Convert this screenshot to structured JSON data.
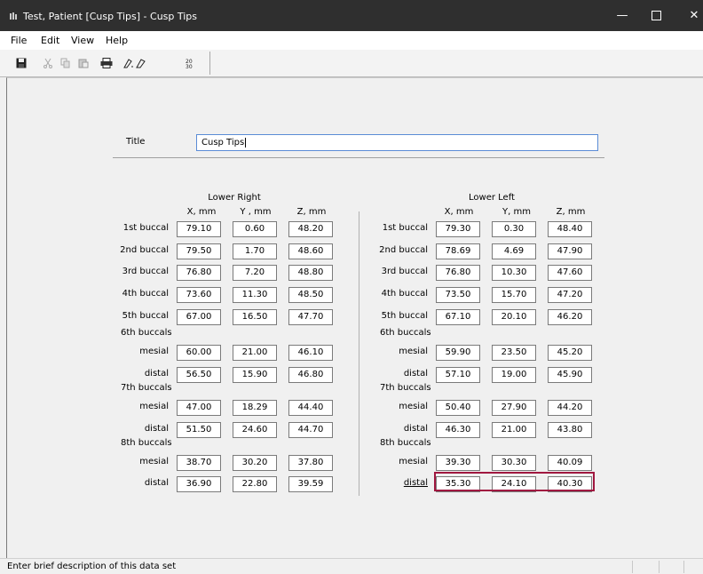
{
  "window": {
    "title": "Test, Patient [Cusp Tips] - Cusp Tips"
  },
  "menu": [
    "File",
    "Edit",
    "View",
    "Help"
  ],
  "form": {
    "title_label": "Title",
    "title_value": "Cusp Tips",
    "left_group": "Lower Right",
    "right_group": "Lower Left",
    "col_headers": [
      "X, mm",
      "Y , mm",
      "Z, mm"
    ],
    "right_col_headers": [
      "X, mm",
      "Y, mm",
      "Z, mm"
    ],
    "labels": {
      "r1": "1st buccal",
      "r2": "2nd buccal",
      "r3": "3rd buccal",
      "r4": "4th buccal",
      "r5": "5th buccal",
      "g6": "6th buccals",
      "g7": "7th buccals",
      "g8": "8th buccals",
      "mesial": "mesial",
      "distal": "distal"
    },
    "lower_right": [
      [
        "79.10",
        "0.60",
        "48.20"
      ],
      [
        "79.50",
        "1.70",
        "48.60"
      ],
      [
        "76.80",
        "7.20",
        "48.80"
      ],
      [
        "73.60",
        "11.30",
        "48.50"
      ],
      [
        "67.00",
        "16.50",
        "47.70"
      ],
      [
        "60.00",
        "21.00",
        "46.10"
      ],
      [
        "56.50",
        "15.90",
        "46.80"
      ],
      [
        "47.00",
        "18.29",
        "44.40"
      ],
      [
        "51.50",
        "24.60",
        "44.70"
      ],
      [
        "38.70",
        "30.20",
        "37.80"
      ],
      [
        "36.90",
        "22.80",
        "39.59"
      ]
    ],
    "lower_left": [
      [
        "79.30",
        "0.30",
        "48.40"
      ],
      [
        "78.69",
        "4.69",
        "47.90"
      ],
      [
        "76.80",
        "10.30",
        "47.60"
      ],
      [
        "73.50",
        "15.70",
        "47.20"
      ],
      [
        "67.10",
        "20.10",
        "46.20"
      ],
      [
        "59.90",
        "23.50",
        "45.20"
      ],
      [
        "57.10",
        "19.00",
        "45.90"
      ],
      [
        "50.40",
        "27.90",
        "44.20"
      ],
      [
        "46.30",
        "21.00",
        "43.80"
      ],
      [
        "39.30",
        "30.30",
        "40.09"
      ],
      [
        "35.30",
        "24.10",
        "40.30"
      ]
    ]
  },
  "status": {
    "text": "Enter brief description of this data set"
  },
  "colors": {
    "titlebar": "#2f2f2f",
    "focus_border": "#a01840",
    "input_focus": "#5b8cd6"
  }
}
